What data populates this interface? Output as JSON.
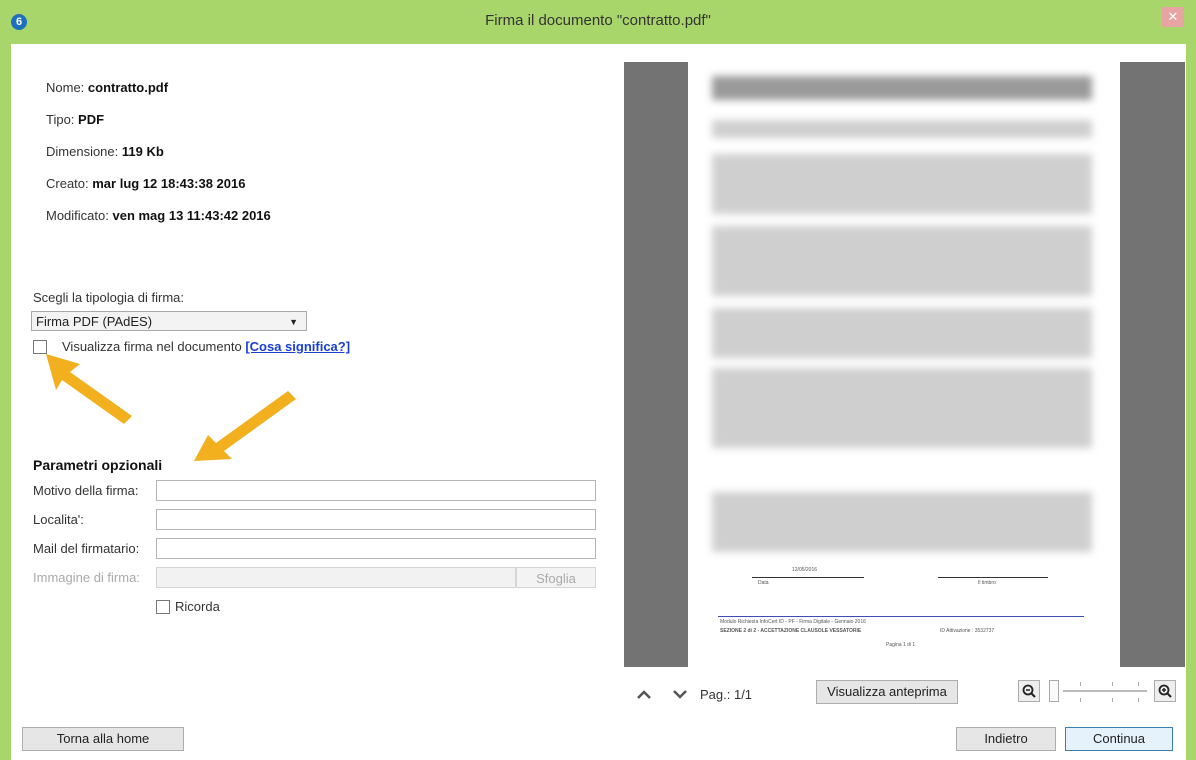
{
  "window": {
    "title": "Firma il documento \"contratto.pdf\"",
    "app_icon_glyph": "6",
    "close_glyph": "✕"
  },
  "file_info": [
    {
      "label": "Nome: ",
      "value": "contratto.pdf"
    },
    {
      "label": "Tipo: ",
      "value": "PDF"
    },
    {
      "label": "Dimensione: ",
      "value": "119 Kb"
    },
    {
      "label": "Creato: ",
      "value": "mar lug 12 18:43:38 2016"
    },
    {
      "label": "Modificato: ",
      "value": "ven mag 13 11:43:42 2016"
    }
  ],
  "signature": {
    "type_label": "Scegli la tipologia di firma:",
    "type_selected": "Firma PDF (PAdES)",
    "show_checkbox_label": "Visualizza firma nel documento",
    "help_link": "[Cosa significa?]"
  },
  "optional": {
    "title": "Parametri opzionali",
    "reason_label": "Motivo della firma:",
    "location_label": "Localita':",
    "email_label": "Mail del firmatario:",
    "image_label": "Immagine di firma:",
    "browse_button": "Sfoglia",
    "remember_label": "Ricorda"
  },
  "preview": {
    "page_label": "Pag.: 1/1",
    "preview_button": "Visualizza anteprima",
    "doc_date": "12/05/2016",
    "doc_date_caption": "Data",
    "doc_sign_caption": "Il timbro",
    "footer_line1": "Modulo Richiesta InfoCert ID - PF - Firma Digitale - Gennaio 2016",
    "footer_line2": "SEZIONE 2 di 2 - ACCETTAZIONE CLAUSOLE VESSATORIE",
    "footer_code": "ID Attivazione : 3532737",
    "footer_page": "Pagina 1 di 1"
  },
  "footer": {
    "home_button": "Torna alla home",
    "back_button": "Indietro",
    "continue_button": "Continua"
  },
  "colors": {
    "titlebar": "#a9d66b",
    "arrow": "#f2b01e",
    "link": "#1a3fd6"
  },
  "icons": {
    "nav_up": "chevron-up-icon",
    "nav_down": "chevron-down-icon",
    "zoom_out": "zoom-out-icon",
    "zoom_in": "zoom-in-icon"
  }
}
